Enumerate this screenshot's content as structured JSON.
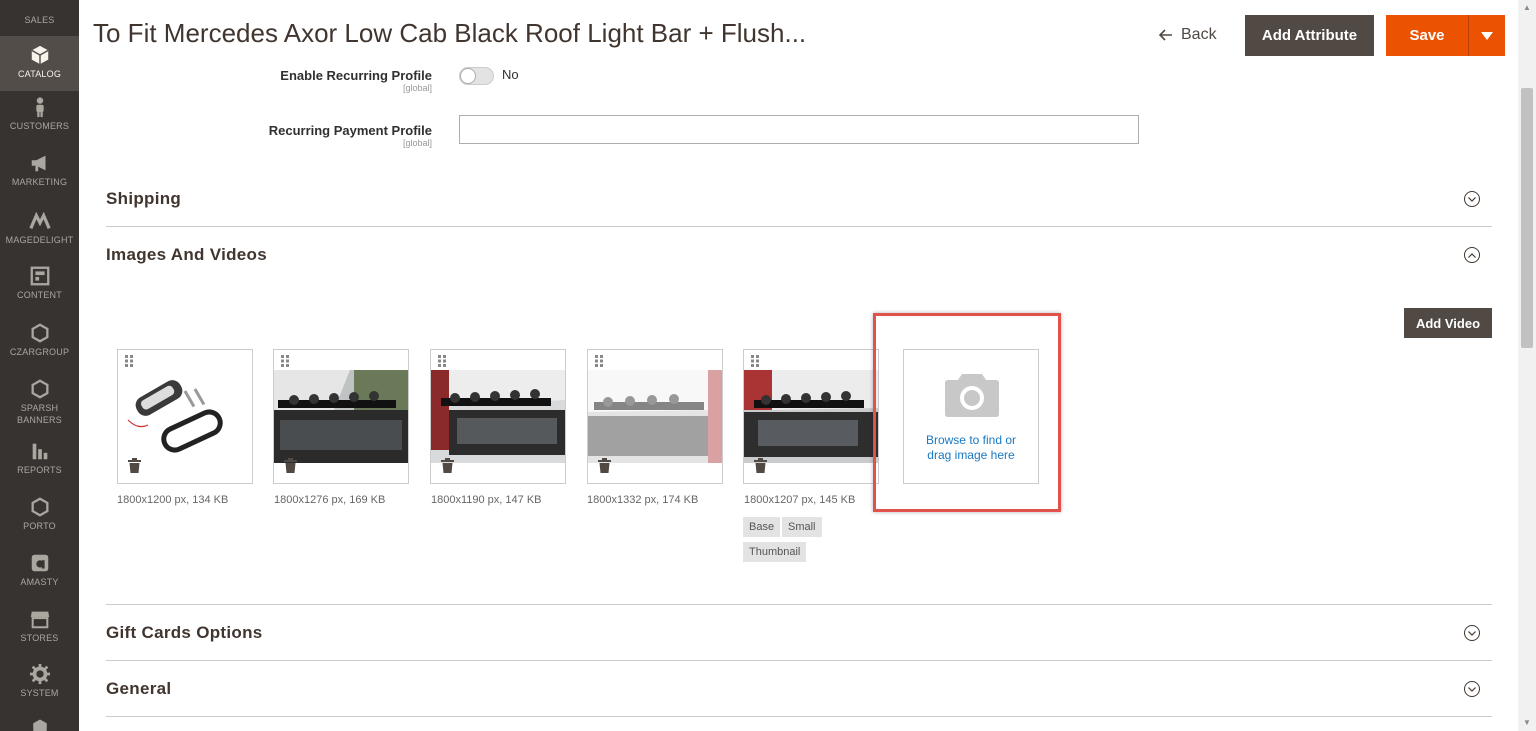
{
  "sidebar": {
    "items": [
      {
        "label": "SALES",
        "icon": "dollar-icon"
      },
      {
        "label": "CATALOG",
        "icon": "cube-icon",
        "active": true
      },
      {
        "label": "CUSTOMERS",
        "icon": "person-icon"
      },
      {
        "label": "MARKETING",
        "icon": "megaphone-icon"
      },
      {
        "label": "MAGEDELIGHT",
        "icon": "magedelight-icon"
      },
      {
        "label": "CONTENT",
        "icon": "content-icon"
      },
      {
        "label": "CZARGROUP",
        "icon": "hexagon-icon"
      },
      {
        "label": "SPARSH BANNERS",
        "icon": "hexagon-icon"
      },
      {
        "label": "REPORTS",
        "icon": "bar-chart-icon"
      },
      {
        "label": "PORTO",
        "icon": "hexagon-icon"
      },
      {
        "label": "AMASTY",
        "icon": "amasty-icon"
      },
      {
        "label": "STORES",
        "icon": "store-icon"
      },
      {
        "label": "SYSTEM",
        "icon": "gear-icon"
      }
    ]
  },
  "header": {
    "title": "To Fit Mercedes Axor Low Cab Black Roof Light Bar + Flush...",
    "back_label": "Back",
    "add_attribute_label": "Add Attribute",
    "save_label": "Save"
  },
  "form": {
    "recurring_profile": {
      "label": "Enable Recurring Profile",
      "scope": "[global]",
      "value": "No"
    },
    "recurring_payment": {
      "label": "Recurring Payment Profile",
      "scope": "[global]",
      "value": ""
    }
  },
  "sections": {
    "shipping": "Shipping",
    "images_videos": "Images And Videos",
    "gift_cards": "Gift Cards Options",
    "general": "General"
  },
  "images": {
    "add_video_label": "Add Video",
    "items": [
      {
        "meta": "1800x1200 px, 134 KB"
      },
      {
        "meta": "1800x1276 px, 169 KB"
      },
      {
        "meta": "1800x1190 px, 147 KB"
      },
      {
        "meta": "1800x1332 px, 174 KB"
      },
      {
        "meta": "1800x1207 px, 145 KB",
        "roles": [
          "Base",
          "Small",
          "Thumbnail"
        ]
      }
    ],
    "upload_text_line1": "Browse to find or",
    "upload_text_line2": "drag image here"
  },
  "colors": {
    "accent": "#eb5202",
    "sidebar": "#373330",
    "highlight": "#e0524a",
    "link": "#1979c3"
  }
}
